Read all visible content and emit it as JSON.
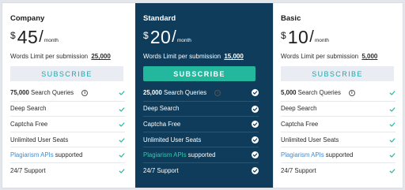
{
  "plans": [
    {
      "name": "Company",
      "currency": "$",
      "amount": "45",
      "slash": "/",
      "period": "month",
      "limit_label": "Words Limit per submission",
      "limit_value": "25,000",
      "button": "SUBSCRIBE",
      "features": [
        {
          "bold": "75,000",
          "text": " Search Queries",
          "info": "i"
        },
        {
          "text": "Deep Search"
        },
        {
          "text": "Captcha Free"
        },
        {
          "text": "Unlimited User Seats"
        },
        {
          "link": "Plagiarism APIs",
          "text": " supported"
        },
        {
          "text": "24/7 Support"
        }
      ]
    },
    {
      "name": "Standard",
      "currency": "$",
      "amount": "20",
      "slash": "/",
      "period": "month",
      "limit_label": "Words Limit per submission",
      "limit_value": "15,000",
      "button": "SUBSCRIBE",
      "features": [
        {
          "bold": "25,000",
          "text": " Search Queries",
          "info": "i"
        },
        {
          "text": "Deep Search"
        },
        {
          "text": "Captcha Free"
        },
        {
          "text": "Unlimited User Seats"
        },
        {
          "link": "Plagiarism APIs",
          "text": " supported"
        },
        {
          "text": "24/7 Support"
        }
      ]
    },
    {
      "name": "Basic",
      "currency": "$",
      "amount": "10",
      "slash": "/",
      "period": "month",
      "limit_label": "Words Limit per submission",
      "limit_value": "5,000",
      "button": "SUBSCRIBE",
      "features": [
        {
          "bold": "5,000",
          "text": " Search Queries",
          "info": "i"
        },
        {
          "text": "Deep Search"
        },
        {
          "text": "Captcha Free"
        },
        {
          "text": "Unlimited User Seats"
        },
        {
          "link": "Plagiarism APIs",
          "text": " supported"
        },
        {
          "text": "24/7 Support"
        }
      ]
    }
  ],
  "colors": {
    "featured_bg": "#0f3c5a",
    "accent_teal": "#23b89d",
    "button_light_bg": "#e9edf3",
    "link_blue": "#3d8bd6",
    "check_teal": "#2bb7a4"
  },
  "icons": {
    "check": "check-icon",
    "info": "info-icon"
  }
}
